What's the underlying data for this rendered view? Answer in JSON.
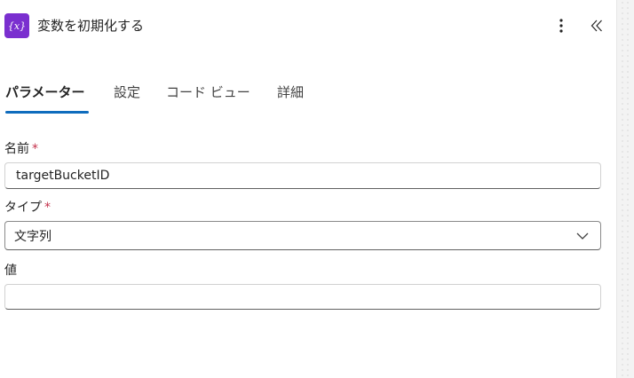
{
  "header": {
    "title": "変数を初期化する",
    "action_icon": "variable-braces-icon",
    "icon_glyph": "{x}",
    "accent_color": "#7a2fcf"
  },
  "tabs": [
    {
      "label": "パラメーター",
      "active": true
    },
    {
      "label": "設定",
      "active": false
    },
    {
      "label": "コード ビュー",
      "active": false
    },
    {
      "label": "詳細",
      "active": false
    }
  ],
  "form": {
    "name": {
      "label": "名前",
      "required_mark": "*",
      "value": "targetBucketID"
    },
    "type": {
      "label": "タイプ",
      "required_mark": "*",
      "selected": "文字列"
    },
    "value": {
      "label": "値",
      "value": ""
    }
  },
  "colors": {
    "tab_active_underline": "#0f6cbd",
    "required": "#c4314b"
  }
}
